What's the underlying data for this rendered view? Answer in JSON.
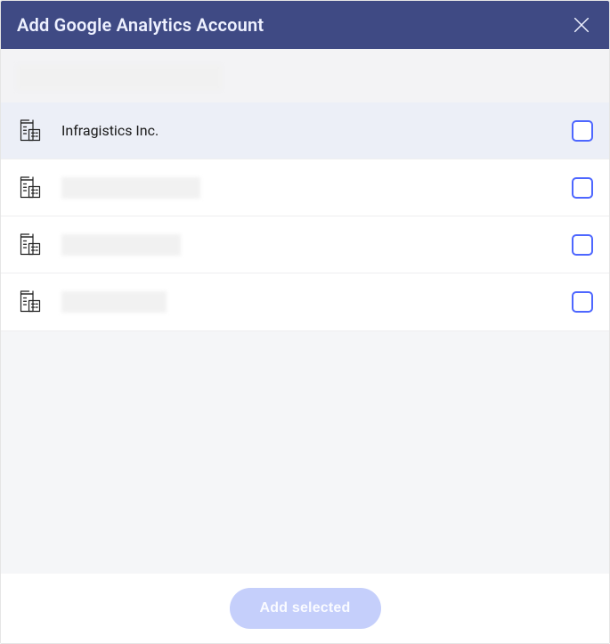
{
  "header": {
    "title": "Add Google Analytics Account"
  },
  "accounts": [
    {
      "name": "Infragistics Inc.",
      "redacted": false,
      "redactedWidth": 0
    },
    {
      "name": "",
      "redacted": true,
      "redactedWidth": 156
    },
    {
      "name": "",
      "redacted": true,
      "redactedWidth": 134
    },
    {
      "name": "",
      "redacted": true,
      "redactedWidth": 118
    }
  ],
  "footer": {
    "addSelectedLabel": "Add selected"
  }
}
